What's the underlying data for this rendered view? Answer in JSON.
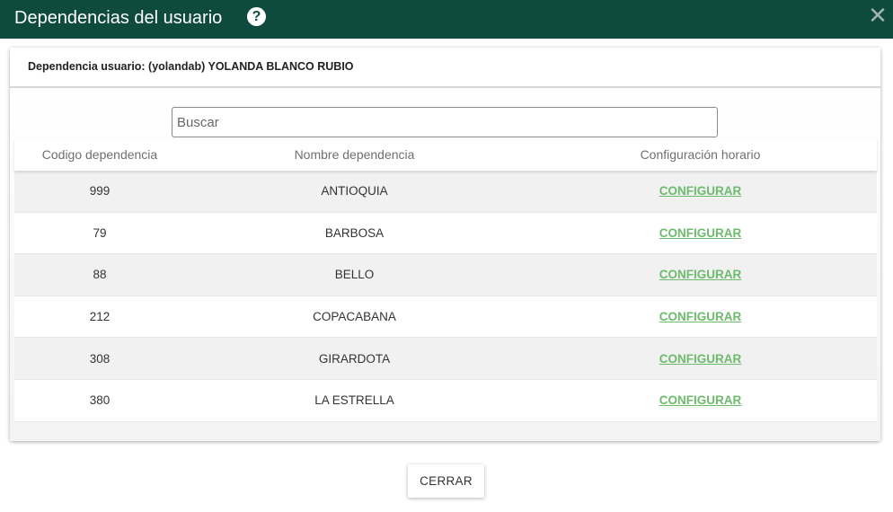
{
  "dialog": {
    "title": "Dependencias del usuario",
    "help_glyph": "?",
    "close_glyph": "✕",
    "close_button_label": "CERRAR"
  },
  "card": {
    "header_label": "Dependencia usuario: (yolandab) YOLANDA BLANCO RUBIO"
  },
  "search": {
    "placeholder": "Buscar",
    "value": ""
  },
  "table": {
    "headers": [
      "Codigo dependencia",
      "Nombre dependencia",
      "Configuración horario"
    ],
    "rows": [
      {
        "code": "999",
        "name": "ANTIOQUIA",
        "action": "CONFIGURAR"
      },
      {
        "code": "79",
        "name": "BARBOSA",
        "action": "CONFIGURAR"
      },
      {
        "code": "88",
        "name": "BELLO",
        "action": "CONFIGURAR"
      },
      {
        "code": "212",
        "name": "COPACABANA",
        "action": "CONFIGURAR"
      },
      {
        "code": "308",
        "name": "GIRARDOTA",
        "action": "CONFIGURAR"
      },
      {
        "code": "380",
        "name": "LA ESTRELLA",
        "action": "CONFIGURAR"
      }
    ]
  },
  "colors": {
    "titlebar": "#0e4a3e",
    "link": "#6dbb6d",
    "row_alt": "#f1f1f1"
  }
}
